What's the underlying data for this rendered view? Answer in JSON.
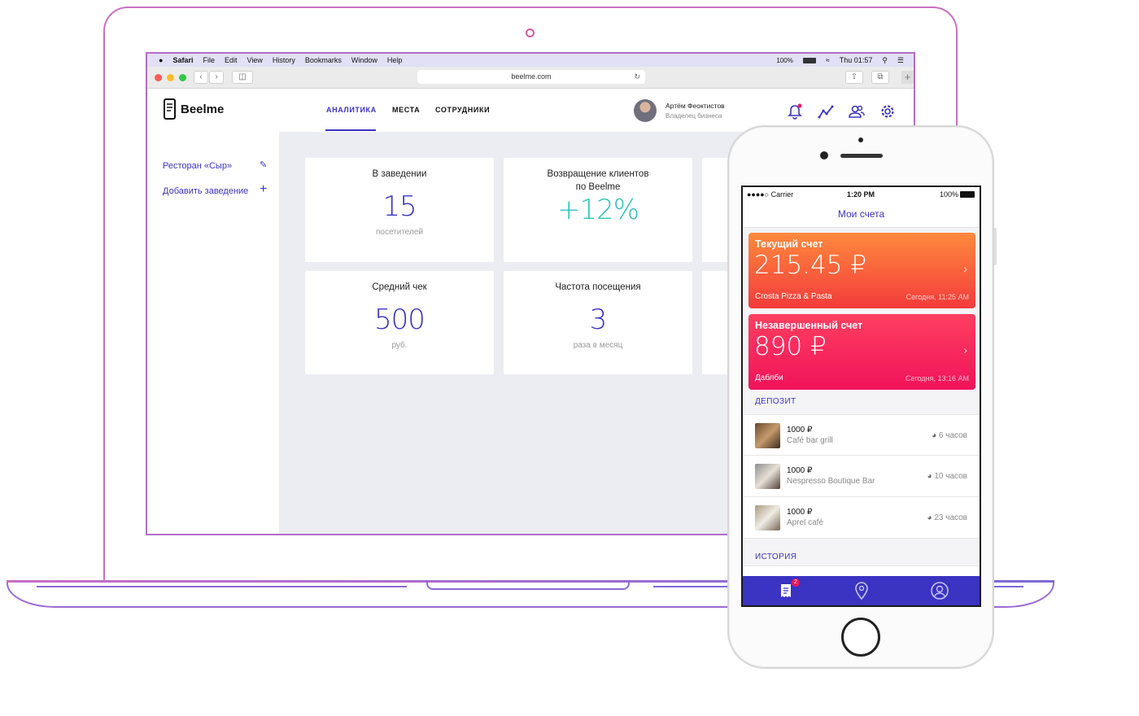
{
  "colors": {
    "accent": "#3b33c2",
    "teal": "#2ec4b6",
    "bell_dot": "#e91e63"
  },
  "mac_menu": {
    "apple": "",
    "items": [
      "Safari",
      "File",
      "Edit",
      "View",
      "History",
      "Bookmarks",
      "Window",
      "Help"
    ],
    "battery": "100%",
    "clock": "Thu 01:57"
  },
  "browser": {
    "url": "beelme.com"
  },
  "app": {
    "logo": "Beelme",
    "tabs": [
      "АНАЛИТИКА",
      "МЕСТА",
      "СОТРУДНИКИ"
    ],
    "user": {
      "name": "Артём Феоктистов",
      "role": "Владелец бизнеса"
    },
    "sidebar": {
      "place": "Ресторан «Сыр»",
      "add": "Добавить заведение"
    },
    "cards": [
      {
        "title": "В заведении",
        "value": "15",
        "sub": "посетителей"
      },
      {
        "title": "Возвращение клиентов\nпо Beelme",
        "value": "+12%",
        "sub": ""
      },
      {
        "title": "Средний чек",
        "value": "500",
        "sub": "руб."
      },
      {
        "title": "Частота посещения",
        "value": "3",
        "sub": "раза в месяц"
      }
    ]
  },
  "phone": {
    "status": {
      "carrier": "●●●●○ Carrier",
      "time": "1:20 PM",
      "battery": "100%"
    },
    "title": "Мои счета",
    "bills": [
      {
        "title": "Текущий счет",
        "amount": "215.45 ₽",
        "place": "Crosta Pizza & Pasta",
        "date": "Сегодня, 11:25 AM"
      },
      {
        "title": "Незавершенный счет",
        "amount": "890 ₽",
        "place": "Даблби",
        "date": "Сегодня, 13:16 AM"
      }
    ],
    "deposit_label": "ДЕПОЗИТ",
    "deposits": [
      {
        "amount": "1000 ₽",
        "place": "Café bar grill",
        "time": "6 часов"
      },
      {
        "amount": "1000 ₽",
        "place": "Nespresso Boutique Bar",
        "time": "10 часов"
      },
      {
        "amount": "1000 ₽",
        "place": "Aprel café",
        "time": "23 часов"
      }
    ],
    "history_label": "ИСТОРИЯ",
    "badge": "2"
  }
}
